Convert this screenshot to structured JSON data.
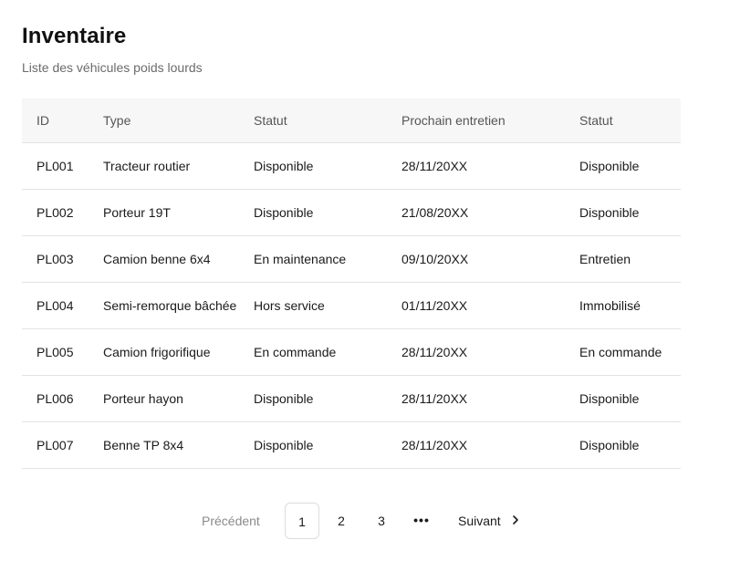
{
  "header": {
    "title": "Inventaire",
    "subtitle": "Liste des véhicules poids lourds"
  },
  "table": {
    "columns": [
      "ID",
      "Type",
      "Statut",
      "Prochain entretien",
      "Statut"
    ],
    "rows": [
      [
        "PL001",
        "Tracteur routier",
        "Disponible",
        "28/11/20XX",
        "Disponible"
      ],
      [
        "PL002",
        "Porteur 19T",
        "Disponible",
        "21/08/20XX",
        "Disponible"
      ],
      [
        "PL003",
        "Camion benne 6x4",
        "En maintenance",
        "09/10/20XX",
        "Entretien"
      ],
      [
        "PL004",
        "Semi-remorque bâchée",
        "Hors service",
        "01/11/20XX",
        "Immobilisé"
      ],
      [
        "PL005",
        "Camion frigorifique",
        "En commande",
        "28/11/20XX",
        "En commande"
      ],
      [
        "PL006",
        "Porteur hayon",
        "Disponible",
        "28/11/20XX",
        "Disponible"
      ],
      [
        "PL007",
        "Benne TP 8x4",
        "Disponible",
        "28/11/20XX",
        "Disponible"
      ]
    ]
  },
  "pagination": {
    "previous_label": "Précédent",
    "pages": [
      "1",
      "2",
      "3"
    ],
    "current_page": "1",
    "ellipsis": "•••",
    "next_label": "Suivant",
    "next_icon": "chevron-right-icon"
  },
  "colors": {
    "header_bg": "#f7f7f7",
    "border": "#e3e3e3",
    "muted_text": "#6b6b6b",
    "disabled_text": "#8a8a8a"
  }
}
